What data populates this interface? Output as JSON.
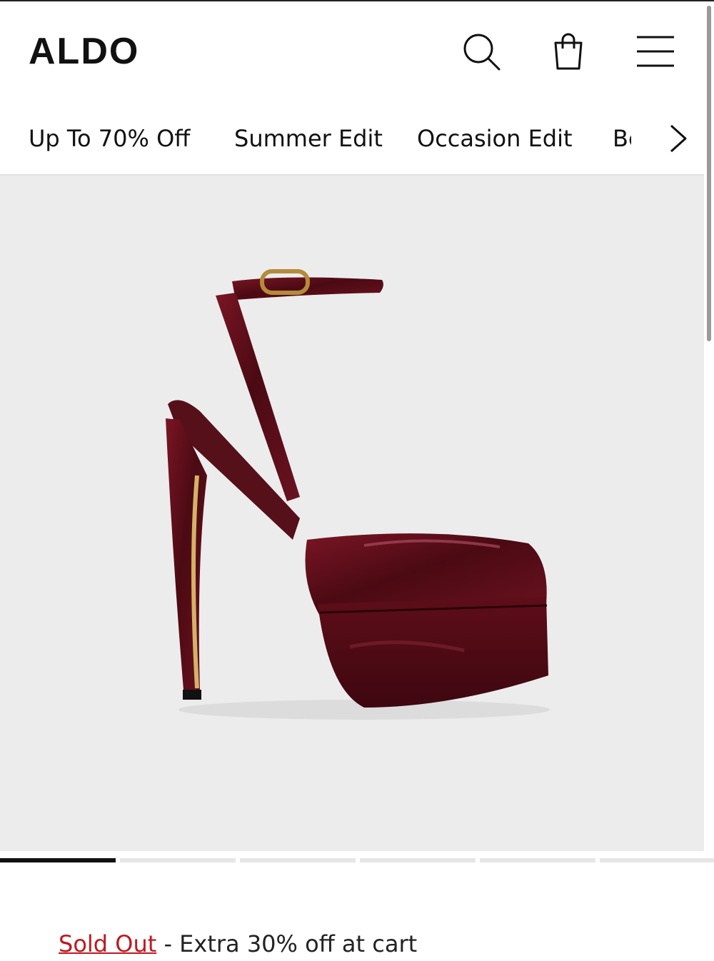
{
  "brand": {
    "logo_text": "ALDO"
  },
  "header": {
    "icons": [
      "search-icon",
      "shopping-bag-icon",
      "hamburger-menu-icon"
    ]
  },
  "categories": [
    {
      "label": "Up To 70% Off"
    },
    {
      "label": "Summer Edit"
    },
    {
      "label": "Occasion Edit"
    },
    {
      "label": "Be"
    }
  ],
  "gallery": {
    "image_alt_icon": "platform-heel-shoe-image",
    "slide_count": 6,
    "active_slide": 1
  },
  "promo": {
    "status": "Sold Out",
    "separator": " - ",
    "message": "Extra 30% off at cart"
  },
  "colors": {
    "text": "#111111",
    "background": "#ffffff",
    "gallery_bg": "#ececed",
    "sold_out": "#c0181f",
    "shoe": "#5b0f18"
  }
}
